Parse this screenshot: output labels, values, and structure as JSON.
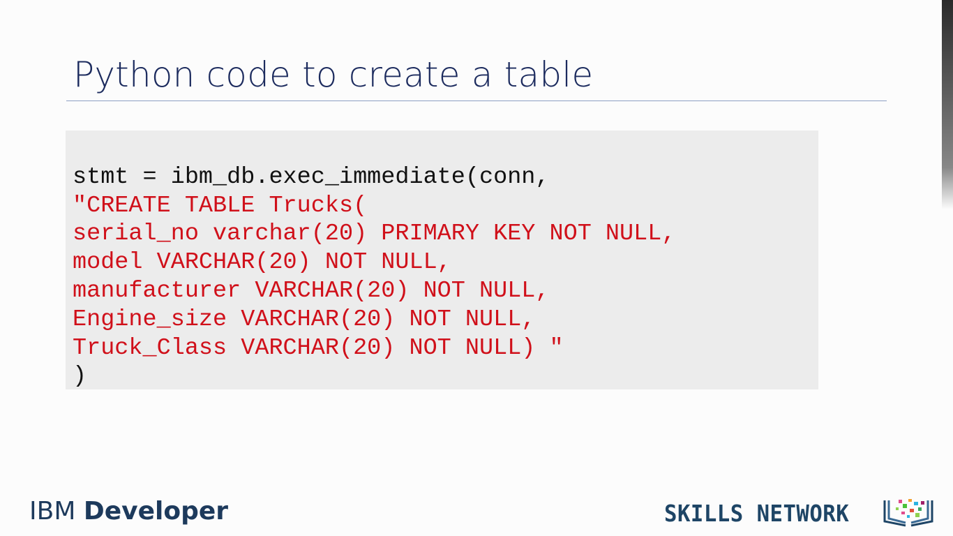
{
  "slide": {
    "title": "Python code to create a table",
    "code_lines": [
      {
        "text": "stmt = ibm_db.exec_immediate(conn,",
        "color": "#111111"
      },
      {
        "text": "\"CREATE TABLE Trucks(",
        "color": "#d0101a"
      },
      {
        "text": "serial_no varchar(20) PRIMARY KEY NOT NULL,",
        "color": "#d0101a"
      },
      {
        "text": "model VARCHAR(20) NOT NULL,",
        "color": "#d0101a"
      },
      {
        "text": "manufacturer VARCHAR(20) NOT NULL,",
        "color": "#d0101a"
      },
      {
        "text": "Engine_size VARCHAR(20) NOT NULL,",
        "color": "#d0101a"
      },
      {
        "text": "Truck_Class VARCHAR(20) NOT NULL) \"",
        "color": "#d0101a"
      },
      {
        "text": ")",
        "color": "#111111"
      }
    ]
  },
  "footer": {
    "ibm_prefix": "IBM",
    "ibm_suffix": "Developer",
    "skills_network": "SKILLS NETWORK",
    "logo_icon": "book-network-icon"
  }
}
